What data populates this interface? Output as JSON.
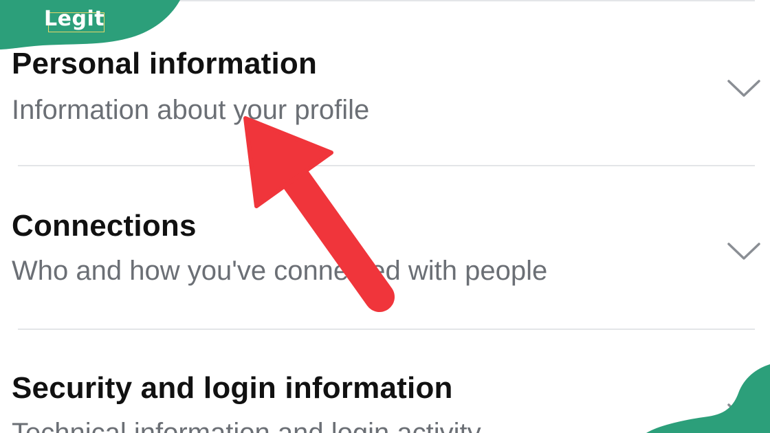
{
  "brand": {
    "logo_text": "Legit",
    "color": "#2c9f7a"
  },
  "sections": [
    {
      "title": "Personal information",
      "subtitle": "Information about your profile"
    },
    {
      "title": "Connections",
      "subtitle": "Who and how you've connected with people"
    },
    {
      "title": "Security and login information",
      "subtitle": "Technical information and login activity"
    }
  ],
  "icons": {
    "expand": "chevron-down-icon",
    "pointer": "red-arrow-annotation"
  },
  "colors": {
    "title": "#111111",
    "subtitle": "#6b6f75",
    "divider": "#e3e5e8",
    "arrow": "#f0353b",
    "brand": "#2c9f7a"
  }
}
